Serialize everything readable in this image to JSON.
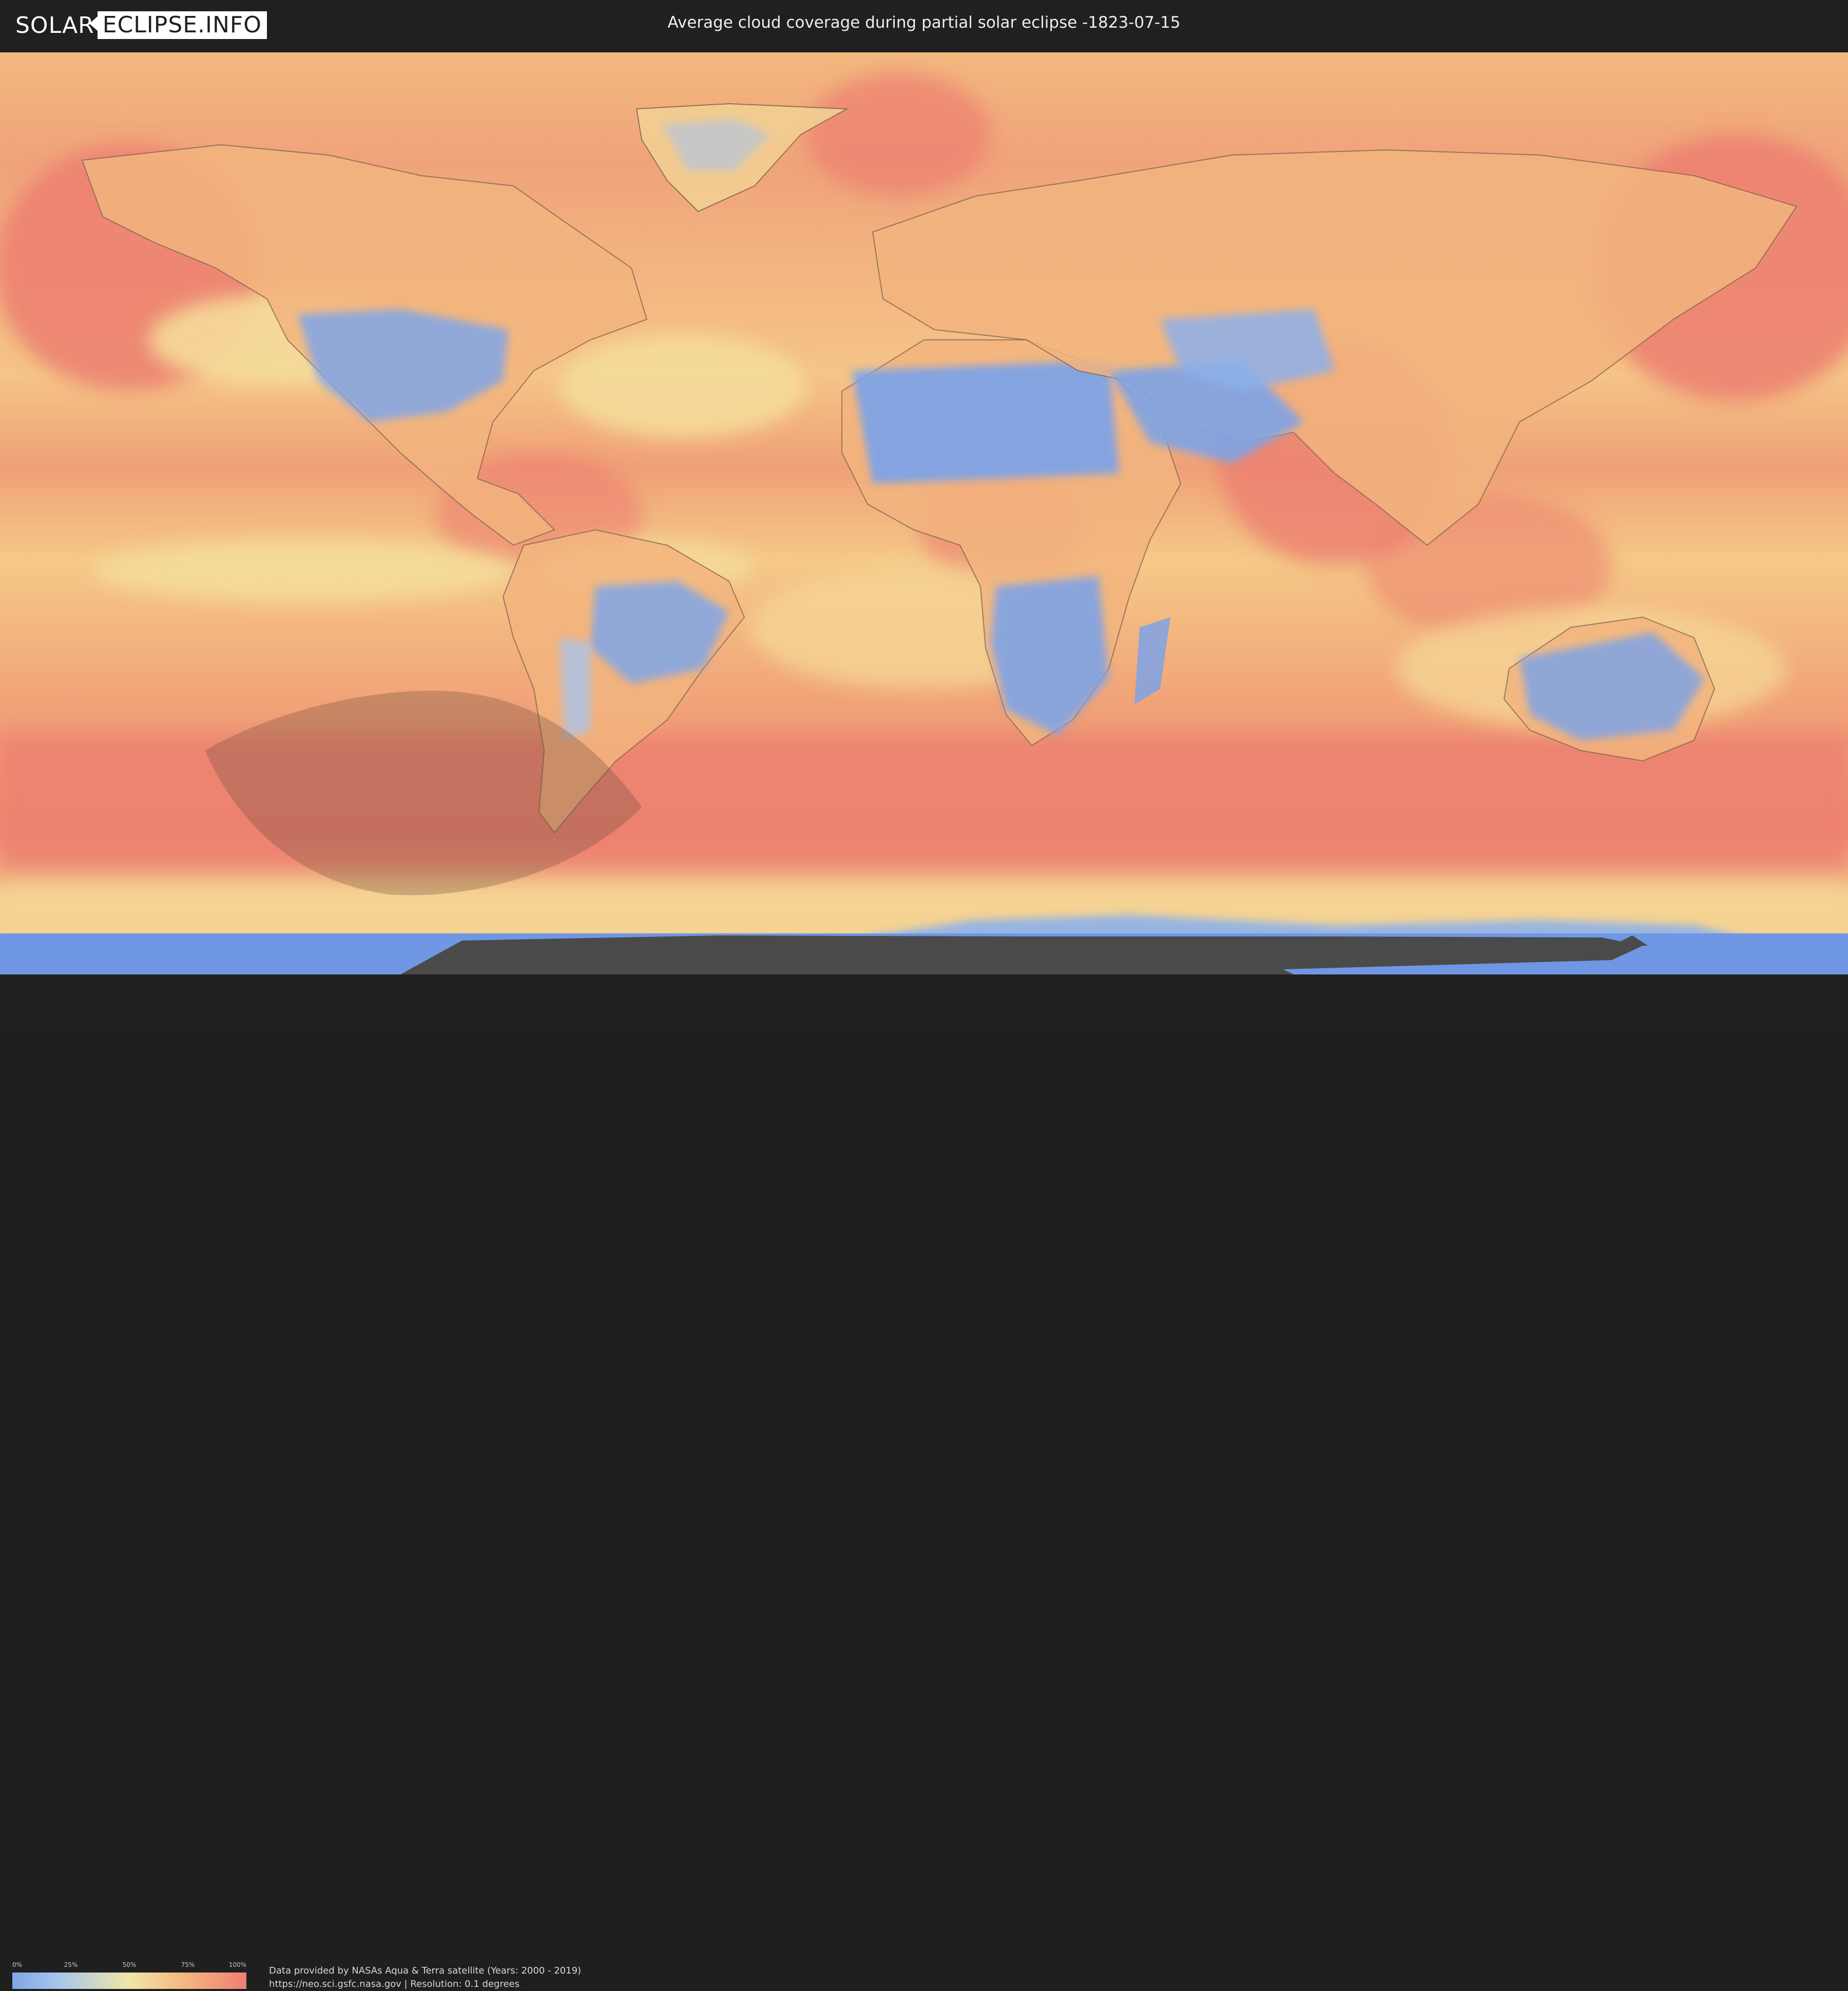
{
  "header": {
    "logo_left": "SOLAR",
    "logo_right": "ECLIPSE.INFO",
    "title": "Average cloud coverage during partial solar eclipse -1823-07-15"
  },
  "legend": {
    "ticks": [
      "0%",
      "25%",
      "50%",
      "75%",
      "100%"
    ],
    "colors": [
      "#7fa6e8",
      "#a9c6ea",
      "#f2e6a6",
      "#f3b47e",
      "#ef7e72"
    ]
  },
  "footer": {
    "credit_line1": "Data provided by NASAs Aqua & Terra satellite (Years: 2000 - 2019)",
    "credit_line2": "https://neo.sci.gsfc.nasa.gov | Resolution: 0.1 degrees"
  },
  "map": {
    "projection": "equirectangular world map",
    "palette": {
      "clear": "#7ea3e6",
      "low": "#a9c4ea",
      "mid": "#f2dc98",
      "high": "#f3ad78",
      "overcast": "#ec7f70",
      "no_data": "#4a4a4a"
    },
    "eclipse_zone_color": "#6a4a3a"
  }
}
